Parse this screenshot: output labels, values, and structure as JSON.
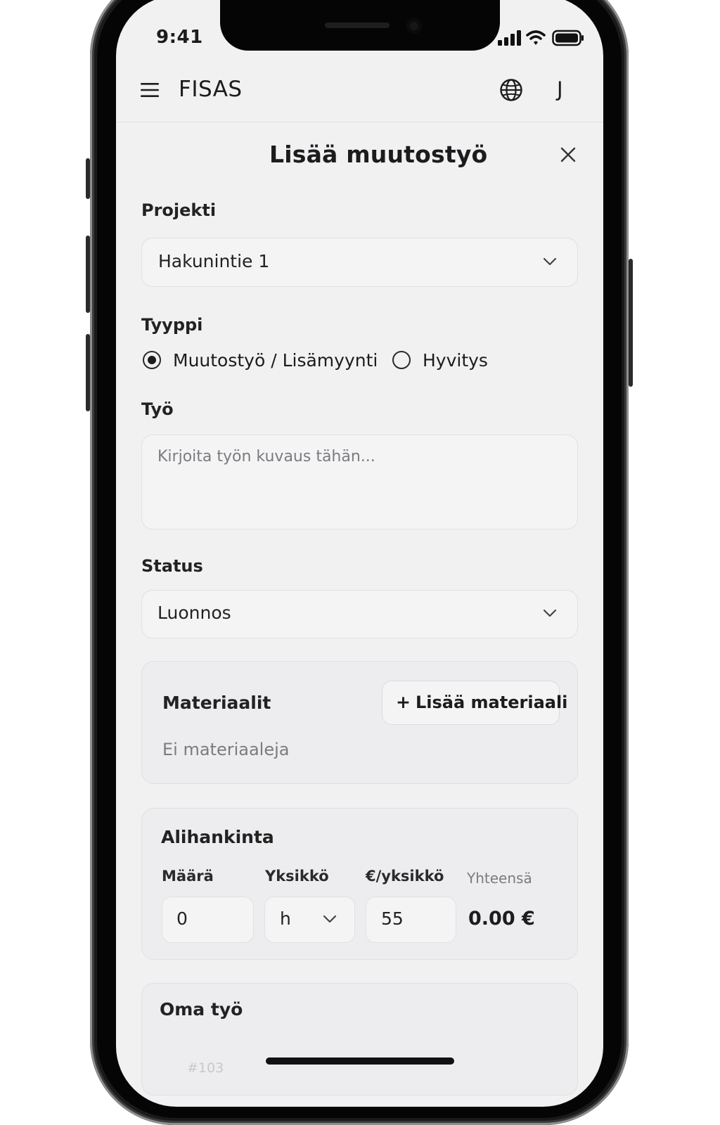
{
  "status_bar": {
    "time": "9:41"
  },
  "header": {
    "app_name": "FISAS",
    "user_initial": "J"
  },
  "modal": {
    "title": "Lisää muutostyö",
    "project": {
      "label": "Projekti",
      "selected": "Hakunintie 1"
    },
    "type": {
      "label": "Tyyppi",
      "options": [
        {
          "label": "Muutostyö / Lisämyynti",
          "selected": true
        },
        {
          "label": "Hyvitys",
          "selected": false
        }
      ]
    },
    "work": {
      "label": "Työ",
      "placeholder": "Kirjoita työn kuvaus tähän..."
    },
    "status": {
      "label": "Status",
      "selected": "Luonnos"
    },
    "materials": {
      "title": "Materiaalit",
      "add_button": "Lisää materiaali",
      "add_symbol": "+",
      "empty_text": "Ei materiaaleja"
    },
    "subcontracting": {
      "title": "Alihankinta",
      "quantity_label": "Määrä",
      "unit_label": "Yksikkö",
      "unit_price_label": "€/yksikkö",
      "total_label": "Yhteensä",
      "quantity": "0",
      "unit": "h",
      "unit_price": "55",
      "total": "0.00 €"
    },
    "own_work": {
      "title": "Oma työ"
    },
    "footer_ref": "#103"
  },
  "colors": {
    "screen_bg": "#f1f1f2",
    "text": "#1c1c1e",
    "muted": "#7b7b80"
  }
}
